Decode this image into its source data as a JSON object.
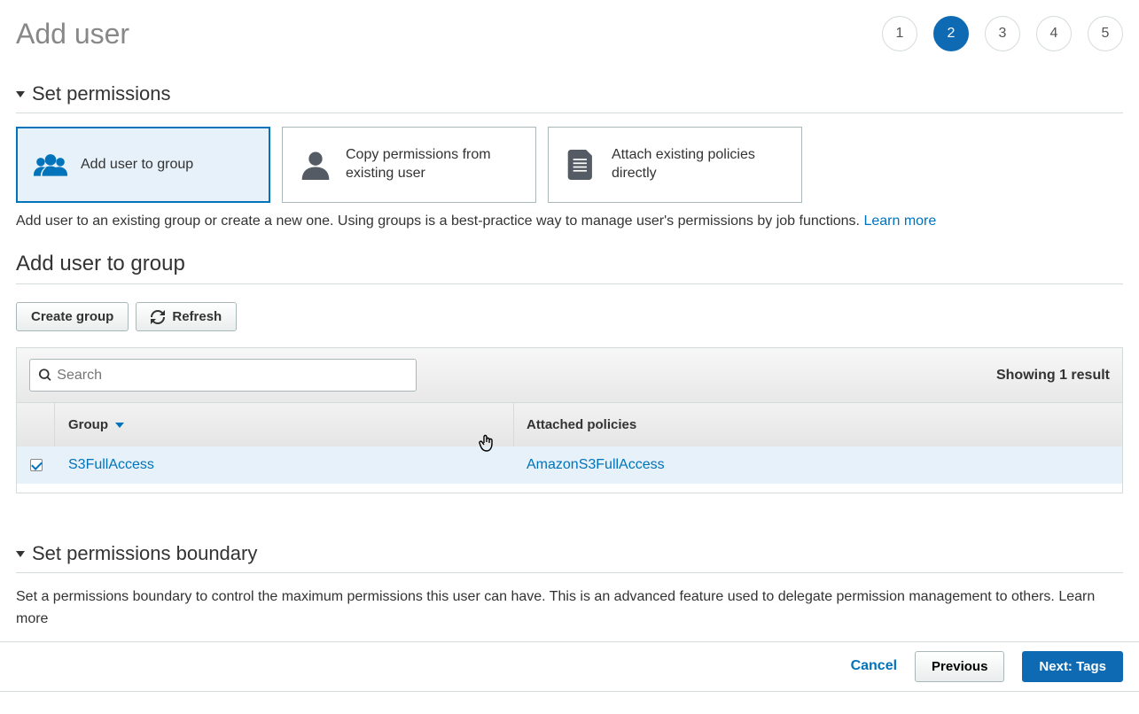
{
  "page_title": "Add user",
  "steps": [
    "1",
    "2",
    "3",
    "4",
    "5"
  ],
  "active_step": 2,
  "sections": {
    "permissions": {
      "title": "Set permissions",
      "cards": [
        {
          "label": "Add user to group",
          "selected": true
        },
        {
          "label": "Copy permissions from existing user",
          "selected": false
        },
        {
          "label": "Attach existing policies directly",
          "selected": false
        }
      ],
      "description": "Add user to an existing group or create a new one. Using groups is a best-practice way to manage user's permissions by job functions. ",
      "learn_more": "Learn more"
    },
    "add_to_group": {
      "title": "Add user to group",
      "create_group_btn": "Create group",
      "refresh_btn": "Refresh",
      "search_placeholder": "Search",
      "result_count": "Showing 1 result",
      "columns": {
        "group": "Group",
        "policies": "Attached policies"
      },
      "rows": [
        {
          "checked": true,
          "group": "S3FullAccess",
          "policies": "AmazonS3FullAccess"
        }
      ]
    },
    "boundary": {
      "title": "Set permissions boundary",
      "description": "Set a permissions boundary to control the maximum permissions this user can have. This is an advanced feature used to delegate permission management to others. ",
      "learn_more": "Learn more"
    }
  },
  "footer": {
    "cancel": "Cancel",
    "previous": "Previous",
    "next": "Next: Tags"
  }
}
